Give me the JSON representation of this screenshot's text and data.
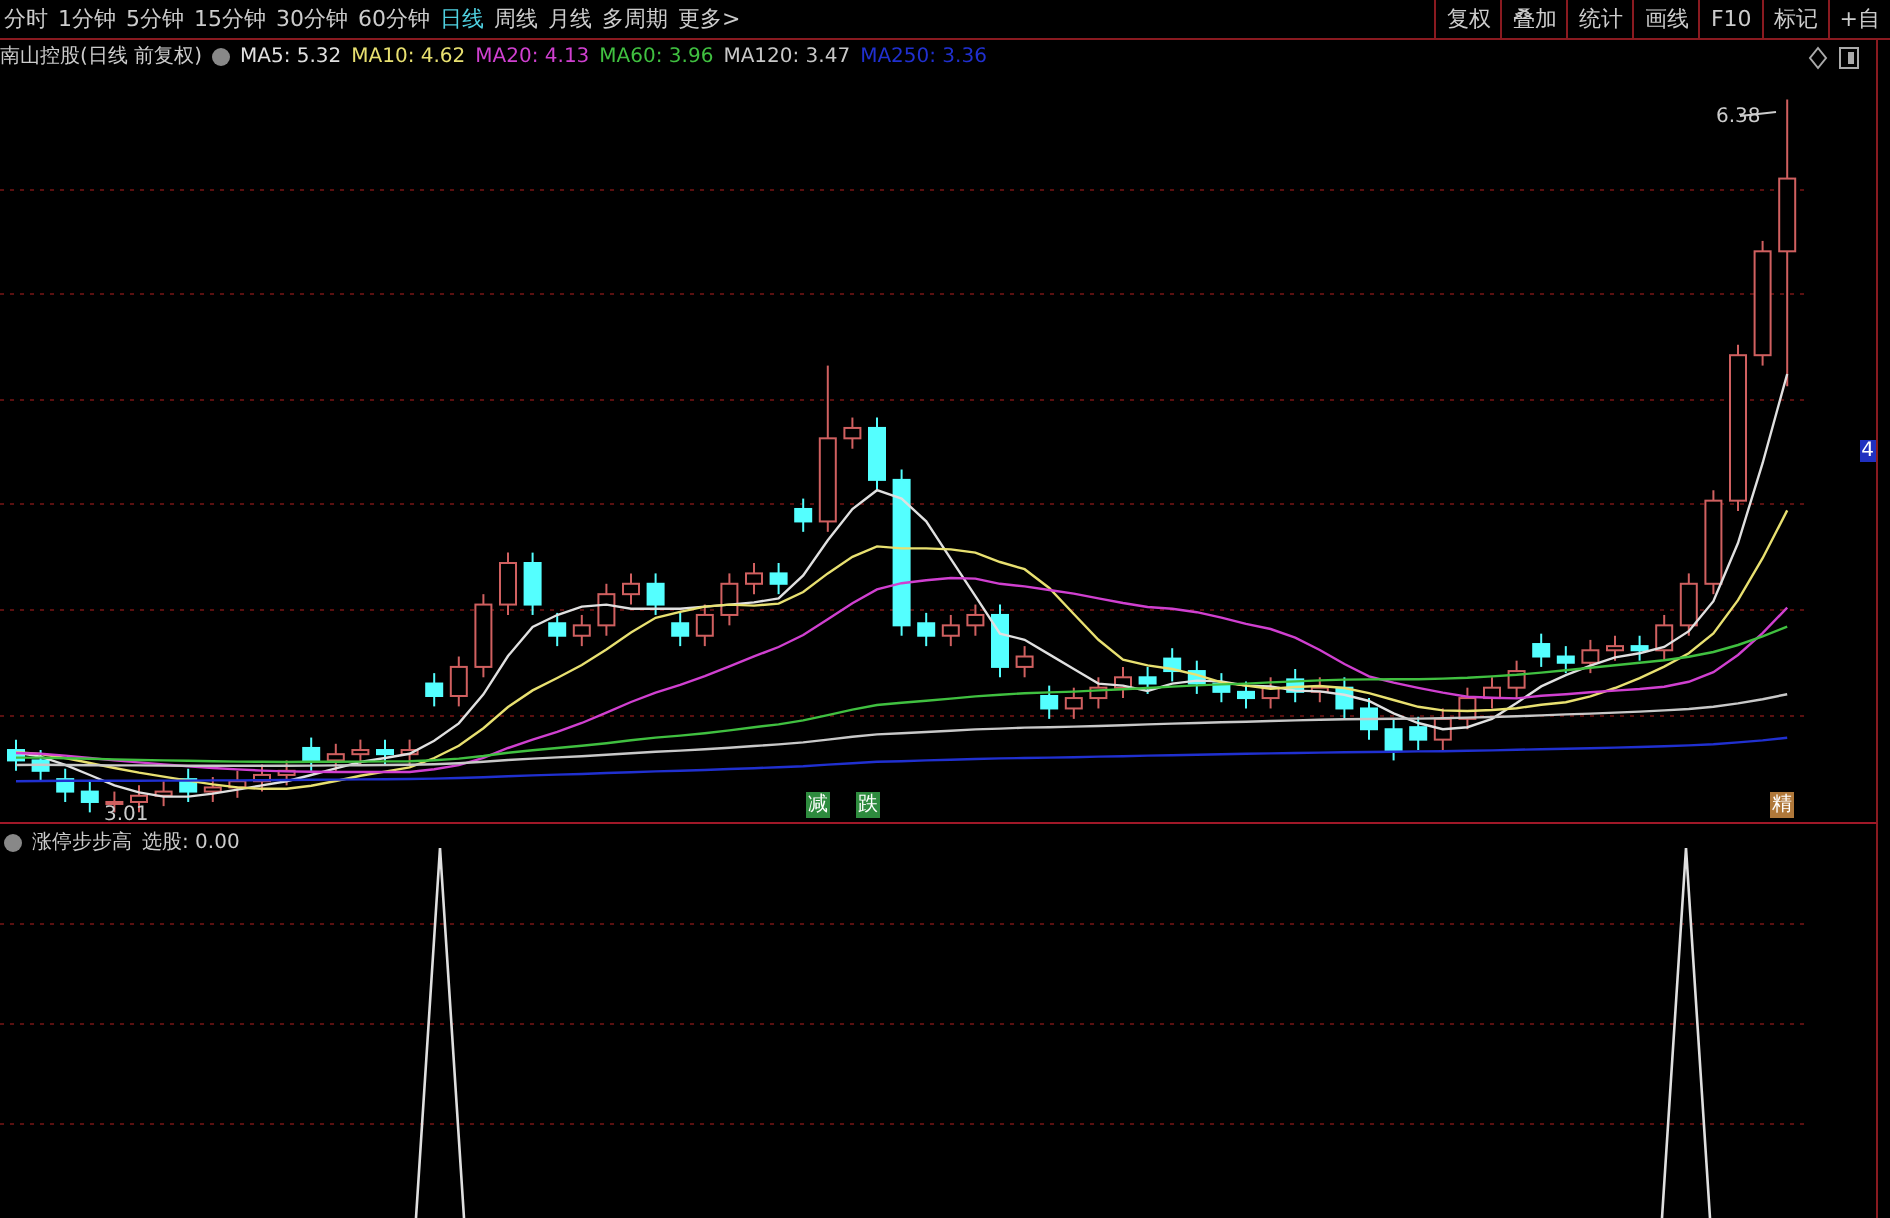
{
  "toolbar": {
    "tabs": [
      {
        "label": "分时",
        "selected": false
      },
      {
        "label": "1分钟",
        "selected": false
      },
      {
        "label": "5分钟",
        "selected": false
      },
      {
        "label": "15分钟",
        "selected": false
      },
      {
        "label": "30分钟",
        "selected": false
      },
      {
        "label": "60分钟",
        "selected": false
      },
      {
        "label": "日线",
        "selected": true
      },
      {
        "label": "周线",
        "selected": false
      },
      {
        "label": "月线",
        "selected": false
      },
      {
        "label": "多周期",
        "selected": false
      },
      {
        "label": "更多>",
        "selected": false
      }
    ],
    "buttons": [
      "复权",
      "叠加",
      "统计",
      "画线",
      "F10",
      "标记",
      "+自"
    ]
  },
  "legend": {
    "title": "南山控股(日线 前复权)",
    "ma": [
      {
        "label": "MA5: 5.32",
        "color": "#e0e0e0"
      },
      {
        "label": "MA10: 4.62",
        "color": "#e8e070"
      },
      {
        "label": "MA20: 4.13",
        "color": "#d040d0"
      },
      {
        "label": "MA60: 3.96",
        "color": "#40c040"
      },
      {
        "label": "MA120: 3.47",
        "color": "#c8c8c8"
      },
      {
        "label": "MA250: 3.36",
        "color": "#2030d0"
      }
    ]
  },
  "price_labels": {
    "high": "6.38",
    "low": "3.01"
  },
  "axis_tag": "4",
  "signals": [
    {
      "label": "减",
      "color": "#2e8b3e"
    },
    {
      "label": "跌",
      "color": "#2e8b3e"
    },
    {
      "label": "精",
      "color": "#b0783a"
    }
  ],
  "indicator": {
    "name": "涨停步步高",
    "value": "选股: 0.00"
  }
}
